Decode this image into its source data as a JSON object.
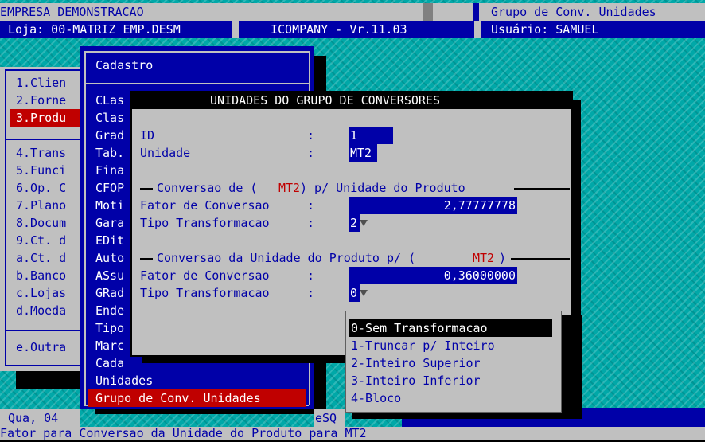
{
  "status_bar": {
    "company": "EMPRESA DEMONSTRACAO",
    "screen_title": "Grupo de Conv. Unidades",
    "store": "Loja: 00-MATRIZ EMP.DESM",
    "app_version": "ICOMPANY - Vr.11.03",
    "user": "Usuário: SAMUEL"
  },
  "main_menu": {
    "items": [
      "1.Clien",
      "2.Forne",
      "3.Produ",
      "4.Trans",
      "5.Funci",
      "6.Op. C",
      "7.Plano",
      "8.Docum",
      "9.Ct. d",
      "a.Ct. d",
      "b.Banco",
      "c.Lojas",
      "d.Moeda",
      "e.Outra"
    ],
    "selected_index": 2
  },
  "cadastro_menu": {
    "title": "Cadastro",
    "items": [
      "CLas",
      "Clas",
      "Grad",
      "Tab.",
      "Fina",
      "CFOP",
      "Moti",
      "Gara",
      "EDit",
      "Auto",
      "ASsu",
      "GRad",
      "Ende",
      "Tipo",
      "Marc",
      "Cada",
      "Unidades",
      "Grupo de Conv. Unidades"
    ],
    "selected_index": 17
  },
  "footer": {
    "date": "Qua, 04",
    "fragment": "eSQ",
    "hint": "Fator para Conversao da Unidade do Produto para MT2"
  },
  "dialog": {
    "title": "UNIDADES DO GRUPO DE CONVERSORES",
    "id_label": "ID",
    "id_value": "1",
    "unidade_label": "Unidade",
    "unidade_value": "MT2",
    "colon": ":",
    "section1": {
      "prefix": "Conversao de (",
      "unit": "MT2",
      "suffix": ") p/ Unidade do Produto",
      "fator_label": "Fator de Conversao",
      "fator_value": "2,77777778",
      "tipo_label": "Tipo Transformacao",
      "tipo_value": "2"
    },
    "section2": {
      "prefix": "Conversao da Unidade do Produto p/ (",
      "unit": "MT2",
      "suffix": ")",
      "fator_label": "Fator de Conversao",
      "fator_value": "0,36000000",
      "tipo_label": "Tipo Transformacao",
      "tipo_value": "0"
    }
  },
  "dropdown": {
    "options": [
      "0-Sem Transformacao",
      "1-Truncar p/ Inteiro",
      "2-Inteiro Superior",
      "3-Inteiro Inferior",
      "4-Bloco"
    ],
    "selected_index": 0
  },
  "colors": {
    "background_pattern": "#00a8a8",
    "menu_blue": "#0000a8",
    "highlight_red": "#c00000",
    "dialog_gray": "#c0c0c0"
  }
}
